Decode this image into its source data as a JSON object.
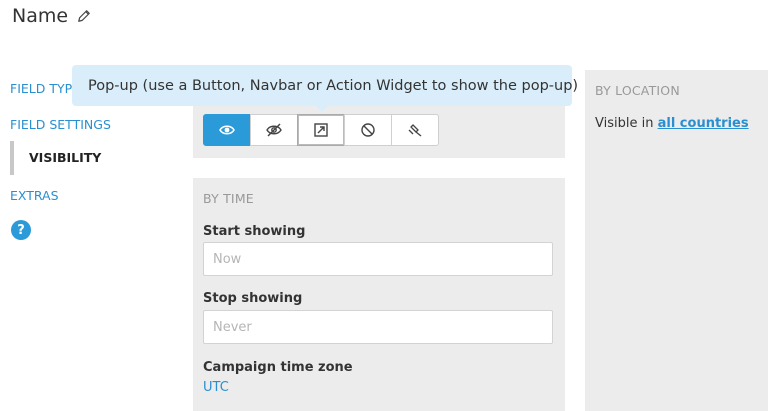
{
  "header": {
    "title": "Name",
    "edit_icon": "pencil-icon"
  },
  "nav": {
    "items": [
      {
        "label": "FIELD TYP",
        "active": false
      },
      {
        "label": "FIELD SETTINGS",
        "active": false
      },
      {
        "label": "VISIBILITY",
        "active": true
      },
      {
        "label": "EXTRAS",
        "active": false
      }
    ],
    "help_label": "?"
  },
  "visibility_modes": {
    "buttons": [
      {
        "icon": "eye-icon",
        "selected": true
      },
      {
        "icon": "eye-slash-icon",
        "selected": false
      },
      {
        "icon": "popup-icon",
        "selected": false
      },
      {
        "icon": "ban-icon",
        "selected": false
      },
      {
        "icon": "gavel-icon",
        "selected": false
      }
    ]
  },
  "tooltip": {
    "text": "Pop-up (use a Button, Navbar or Action Widget to show the pop-up)"
  },
  "by_time": {
    "section_label": "BY TIME",
    "start_label": "Start showing",
    "start_placeholder": "Now",
    "stop_label": "Stop showing",
    "stop_placeholder": "Never",
    "timezone_label": "Campaign time zone",
    "timezone_value": "UTC"
  },
  "by_location": {
    "section_label": "BY LOCATION",
    "visible_prefix": "Visible in",
    "visible_link": "all countries"
  },
  "colors": {
    "accent": "#2a9bd8",
    "panel": "#ececec",
    "tooltip": "#d9eefa"
  }
}
